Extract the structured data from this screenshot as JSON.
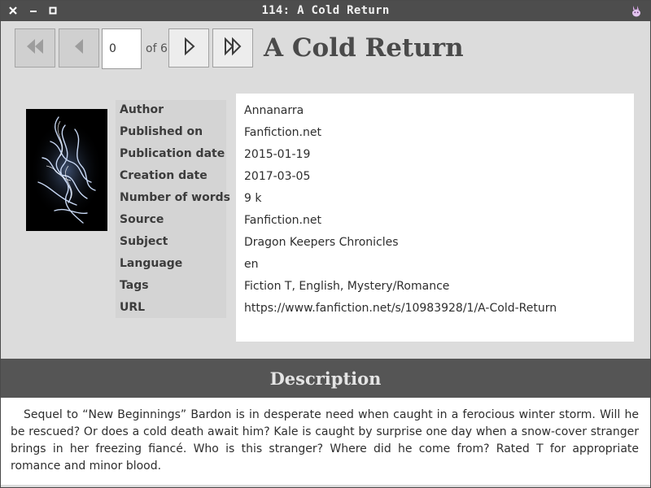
{
  "window": {
    "title": "114: A Cold Return"
  },
  "navigation": {
    "current_page": "0",
    "of_label": "of 6",
    "icons": {
      "first": "skip-to-first-icon",
      "previous": "previous-icon",
      "next": "next-icon",
      "last": "skip-to-last-icon"
    }
  },
  "book": {
    "title": "A Cold Return",
    "cover_icon": "book-cover-image"
  },
  "metadata": {
    "labels": [
      "Author",
      "Published on",
      "Publication date",
      "Creation date",
      "Number of words",
      "Source",
      "Subject",
      "Language",
      "Tags",
      "URL"
    ],
    "values": [
      "Annanarra",
      "Fanfiction.net",
      "2015-01-19",
      "2017-03-05",
      "9 k",
      "Fanfiction.net",
      "Dragon Keepers Chronicles",
      "en",
      "Fiction  T, English, Mystery/Romance",
      "https://www.fanfiction.net/s/10983928/1/A-Cold-Return"
    ]
  },
  "description": {
    "header": "Description",
    "text": "Sequel to “New Beginnings” Bardon is in desperate need when caught in a ferocious winter storm. Will he be rescued? Or does a cold death await him? Kale is caught by surprise one day when a snow-cover stranger brings in her freezing fiancé. Who is this stranger? Where did he come from? Rated T for appropriate romance and minor blood."
  }
}
